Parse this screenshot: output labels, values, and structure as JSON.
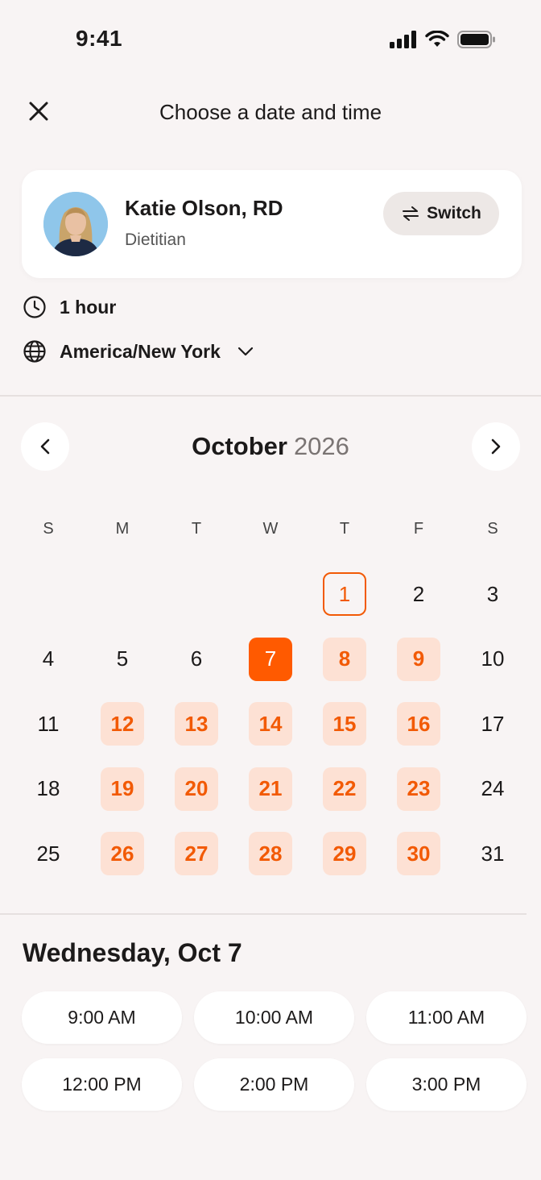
{
  "status_bar": {
    "time": "9:41"
  },
  "header": {
    "title": "Choose a date and time"
  },
  "provider": {
    "name": "Katie Olson, RD",
    "role": "Dietitian",
    "switch_label": "Switch"
  },
  "appointment": {
    "duration": "1 hour",
    "timezone": "America/New York"
  },
  "calendar": {
    "month": "October",
    "year": "2026",
    "weekdays": [
      "S",
      "M",
      "T",
      "W",
      "T",
      "F",
      "S"
    ],
    "leading_blanks": 4,
    "days": [
      {
        "n": "1",
        "state": "today"
      },
      {
        "n": "2",
        "state": "normal"
      },
      {
        "n": "3",
        "state": "normal"
      },
      {
        "n": "4",
        "state": "normal"
      },
      {
        "n": "5",
        "state": "normal"
      },
      {
        "n": "6",
        "state": "normal"
      },
      {
        "n": "7",
        "state": "selected"
      },
      {
        "n": "8",
        "state": "available"
      },
      {
        "n": "9",
        "state": "available"
      },
      {
        "n": "10",
        "state": "normal"
      },
      {
        "n": "11",
        "state": "normal"
      },
      {
        "n": "12",
        "state": "available"
      },
      {
        "n": "13",
        "state": "available"
      },
      {
        "n": "14",
        "state": "available"
      },
      {
        "n": "15",
        "state": "available"
      },
      {
        "n": "16",
        "state": "available"
      },
      {
        "n": "17",
        "state": "normal"
      },
      {
        "n": "18",
        "state": "normal"
      },
      {
        "n": "19",
        "state": "available"
      },
      {
        "n": "20",
        "state": "available"
      },
      {
        "n": "21",
        "state": "available"
      },
      {
        "n": "22",
        "state": "available"
      },
      {
        "n": "23",
        "state": "available"
      },
      {
        "n": "24",
        "state": "normal"
      },
      {
        "n": "25",
        "state": "normal"
      },
      {
        "n": "26",
        "state": "available"
      },
      {
        "n": "27",
        "state": "available"
      },
      {
        "n": "28",
        "state": "available"
      },
      {
        "n": "29",
        "state": "available"
      },
      {
        "n": "30",
        "state": "available"
      },
      {
        "n": "31",
        "state": "normal"
      }
    ]
  },
  "selected_date": "Wednesday, Oct 7",
  "time_slots": [
    "9:00 AM",
    "10:00 AM",
    "11:00 AM",
    "12:00 PM",
    "2:00 PM",
    "3:00 PM"
  ],
  "colors": {
    "accent": "#ff5a00",
    "available_bg": "#fde1d4",
    "background": "#f8f4f4"
  },
  "icons": {
    "close": "close-icon",
    "switch": "swap-arrows-icon",
    "duration": "clock-icon",
    "timezone": "globe-icon",
    "timezone_dropdown": "chevron-down-icon",
    "prev_month": "chevron-left-icon",
    "next_month": "chevron-right-icon"
  }
}
